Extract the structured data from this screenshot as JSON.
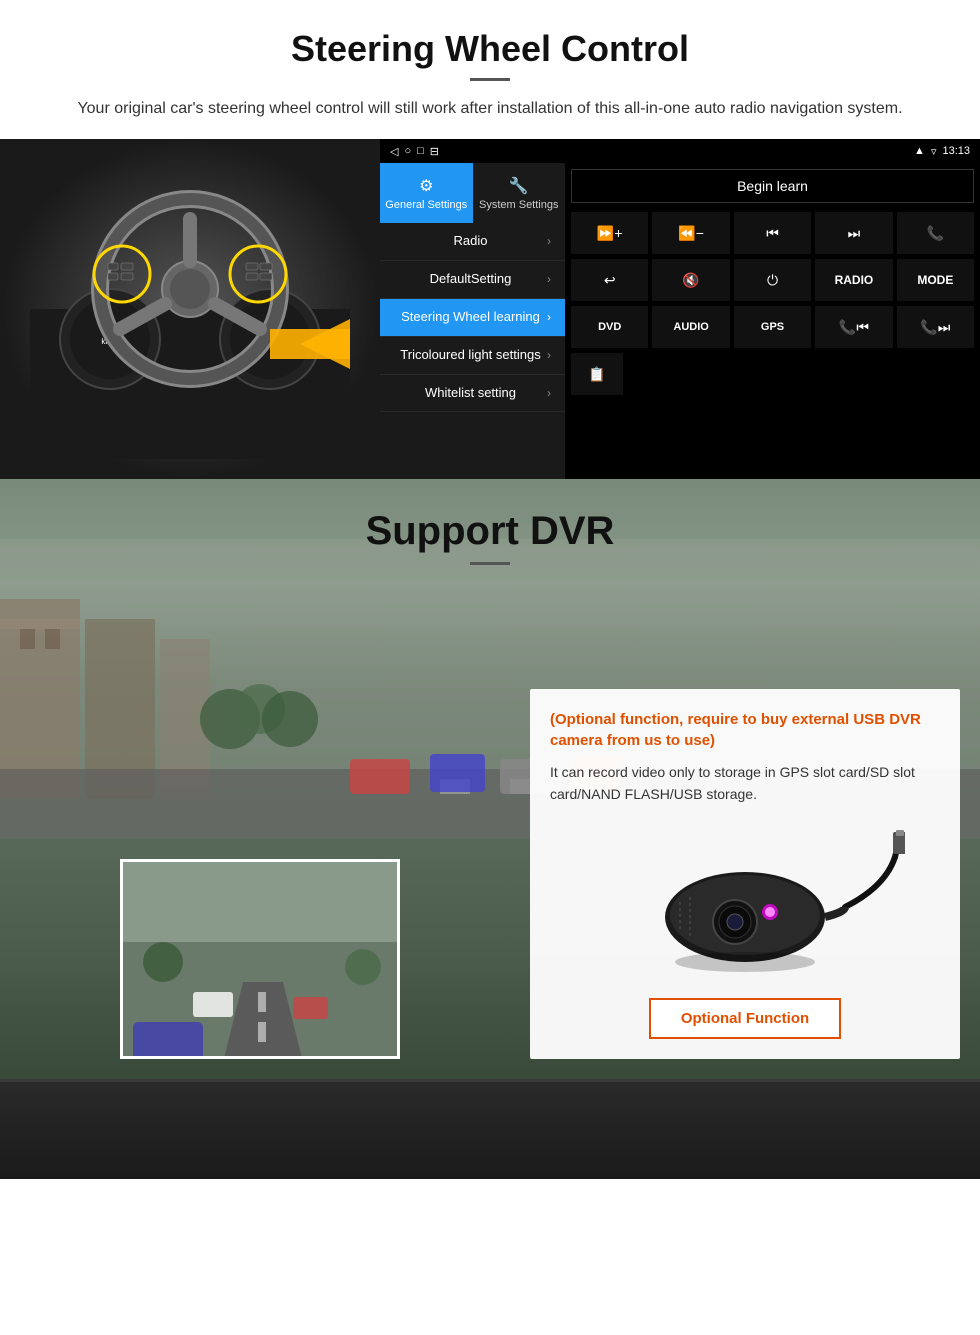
{
  "steering": {
    "title": "Steering Wheel Control",
    "description": "Your original car's steering wheel control will still work after installation of this all-in-one auto radio navigation system.",
    "statusBar": {
      "time": "13:13"
    },
    "tabs": [
      {
        "label": "General Settings",
        "icon": "⚙",
        "active": true
      },
      {
        "label": "System Settings",
        "icon": "🔧",
        "active": false
      }
    ],
    "menuItems": [
      {
        "label": "Radio",
        "active": false
      },
      {
        "label": "DefaultSetting",
        "active": false
      },
      {
        "label": "Steering Wheel learning",
        "active": true
      },
      {
        "label": "Tricoloured light settings",
        "active": false
      },
      {
        "label": "Whitelist setting",
        "active": false
      }
    ],
    "beginLearnBtn": "Begin learn",
    "controlButtons": [
      [
        "⏭+",
        "⏮−",
        "⏮⏮",
        "⏭⏭",
        "📞"
      ],
      [
        "↩",
        "🔇",
        "⏻",
        "RADIO",
        "MODE"
      ],
      [
        "DVD",
        "AUDIO",
        "GPS",
        "📞⏮",
        "📞⏭"
      ]
    ],
    "extraBtn": "📋"
  },
  "dvr": {
    "title": "Support DVR",
    "optionalText": "(Optional function, require to buy external USB DVR camera from us to use)",
    "description": "It can record video only to storage in GPS slot card/SD slot card/NAND FLASH/USB storage.",
    "optionalFunctionBtn": "Optional Function"
  }
}
